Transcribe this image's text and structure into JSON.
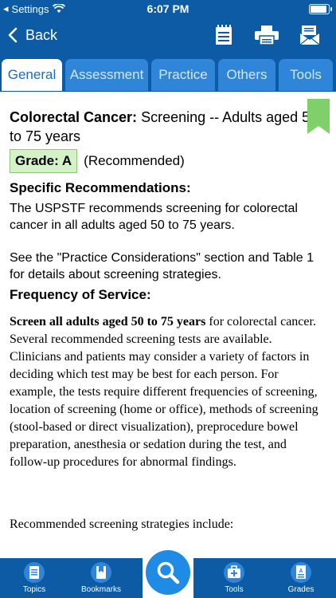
{
  "status": {
    "carrier": "Settings",
    "time": "6:07 PM"
  },
  "header": {
    "back_label": "Back"
  },
  "tabs": [
    {
      "label": "General",
      "active": true
    },
    {
      "label": "Assessment",
      "active": false
    },
    {
      "label": "Practice",
      "active": false
    },
    {
      "label": "Others",
      "active": false
    },
    {
      "label": "Tools",
      "active": false
    }
  ],
  "content": {
    "title_bold": "Colorectal Cancer:",
    "title_rest": " Screening -- Adults aged 50 to 75 years",
    "grade_label": "Grade: A",
    "grade_note": "(Recommended)",
    "specific_heading": "Specific Recommendations:",
    "specific_p1": "The USPSTF recommends screening for colorectal cancer in all adults aged 50 to 75 years.",
    "specific_p2": "See the \"Practice Considerations\" section and Table 1 for details about screening strategies.",
    "frequency_heading": "Frequency of Service:",
    "frequency_bold": "Screen all adults aged 50 to 75 years",
    "frequency_text": " for colorectal cancer. Several recommended screening tests are available. Clinicians and patients may consider a variety of factors in deciding which test may be best for each person. For example, the tests require different frequencies of screening, location of screening (home or office), methods of screening (stool-based or direct visualization), preprocedure bowel preparation, anesthesia or sedation during the test, and follow-up procedures for abnormal findings.",
    "strategies_text": "Recommended screening strategies include:"
  },
  "bottom_nav": {
    "topics": "Topics",
    "bookmarks": "Bookmarks",
    "tools": "Tools",
    "grades": "Grades"
  },
  "colors": {
    "header": "#0c5ba4",
    "tab": "#2f86d8",
    "search": "#1f8be5",
    "grade_bg": "#d4f1c8",
    "bookmark": "#7fd06b"
  }
}
